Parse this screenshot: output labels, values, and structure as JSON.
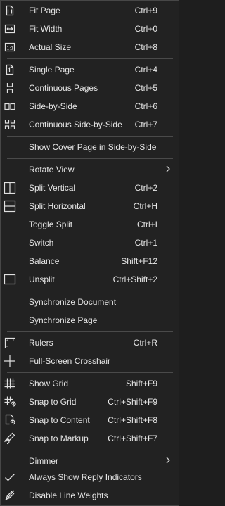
{
  "menu": {
    "items": [
      {
        "label": "Fit Page",
        "shortcut": "Ctrl+9",
        "icon": "fit-page-icon"
      },
      {
        "label": "Fit Width",
        "shortcut": "Ctrl+0",
        "icon": "fit-width-icon"
      },
      {
        "label": "Actual Size",
        "shortcut": "Ctrl+8",
        "icon": "actual-size-icon"
      },
      {
        "label": "Single Page",
        "shortcut": "Ctrl+4",
        "icon": "single-page-icon"
      },
      {
        "label": "Continuous Pages",
        "shortcut": "Ctrl+5",
        "icon": "continuous-pages-icon"
      },
      {
        "label": "Side-by-Side",
        "shortcut": "Ctrl+6",
        "icon": "side-by-side-icon"
      },
      {
        "label": "Continuous Side-by-Side",
        "shortcut": "Ctrl+7",
        "icon": "continuous-side-by-side-icon"
      },
      {
        "label": "Show Cover Page in Side-by-Side",
        "shortcut": ""
      },
      {
        "label": "Rotate View",
        "shortcut": "",
        "submenu": true
      },
      {
        "label": "Split Vertical",
        "shortcut": "Ctrl+2",
        "icon": "split-vertical-icon"
      },
      {
        "label": "Split Horizontal",
        "shortcut": "Ctrl+H",
        "icon": "split-horizontal-icon"
      },
      {
        "label": "Toggle Split",
        "shortcut": "Ctrl+I"
      },
      {
        "label": "Switch",
        "shortcut": "Ctrl+1"
      },
      {
        "label": "Balance",
        "shortcut": "Shift+F12"
      },
      {
        "label": "Unsplit",
        "shortcut": "Ctrl+Shift+2",
        "icon": "unsplit-icon"
      },
      {
        "label": "Synchronize Document",
        "shortcut": ""
      },
      {
        "label": "Synchronize Page",
        "shortcut": ""
      },
      {
        "label": "Rulers",
        "shortcut": "Ctrl+R",
        "icon": "rulers-icon"
      },
      {
        "label": "Full-Screen Crosshair",
        "shortcut": "",
        "icon": "crosshair-icon"
      },
      {
        "label": "Show Grid",
        "shortcut": "Shift+F9",
        "icon": "grid-icon"
      },
      {
        "label": "Snap to Grid",
        "shortcut": "Ctrl+Shift+F9",
        "icon": "snap-to-grid-icon"
      },
      {
        "label": "Snap to Content",
        "shortcut": "Ctrl+Shift+F8",
        "icon": "snap-to-content-icon"
      },
      {
        "label": "Snap to Markup",
        "shortcut": "Ctrl+Shift+F7",
        "icon": "snap-to-markup-icon"
      },
      {
        "label": "Dimmer",
        "shortcut": "",
        "submenu": true
      },
      {
        "label": "Always Show Reply Indicators",
        "shortcut": "",
        "icon": "checkmark-icon",
        "checked": true
      },
      {
        "label": "Disable Line Weights",
        "shortcut": "",
        "icon": "disable-line-weights-icon"
      }
    ]
  },
  "colors": {
    "background": "#222222",
    "border": "#474747",
    "text": "#e6e6e6",
    "separator": "#4a4a4a"
  }
}
